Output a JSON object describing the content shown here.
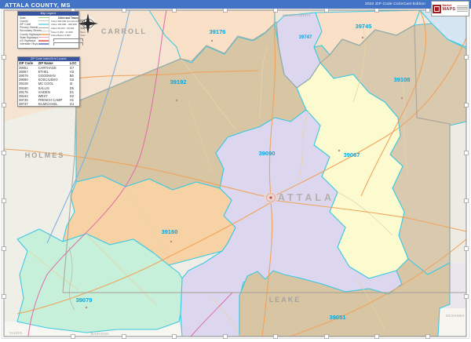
{
  "header": {
    "title": "ATTALA COUNTY, MS",
    "edition": "2022 ZIP Code ColorCast Edition",
    "logo_brand_top": "Market",
    "logo_brand_bottom": "MAPS"
  },
  "legend": {
    "title": "Map Legend",
    "items": [
      {
        "label": "State",
        "color": "#9dd17e"
      },
      {
        "label": "County",
        "color": "#c9c4ba"
      },
      {
        "label": "ZIP Code",
        "color": "#8fdcec"
      },
      {
        "label": "Primary Streets",
        "color": "#a8a29a"
      },
      {
        "label": "Secondary Streets",
        "color": "#d8d2c8"
      },
      {
        "label": "County Highways",
        "color": "#f4b97c"
      },
      {
        "label": "State Highways",
        "color": "#f39bc3"
      },
      {
        "label": "US Highways",
        "color": "#e87b74"
      },
      {
        "label": "Interstate Hwys",
        "color": "#7b93d8"
      }
    ],
    "cities_title": "Cities and Towns",
    "cities": [
      {
        "label": "Cities 500,000 and Above",
        "sample": "CITY"
      },
      {
        "label": "Cities 100,000 - 499,999",
        "sample": "City"
      },
      {
        "label": "Cities 25,000 - 99,999",
        "sample": "City"
      },
      {
        "label": "Cities 5,000 - 24,999",
        "sample": "Town"
      },
      {
        "label": "Cities Below 5,000",
        "sample": "Town"
      }
    ]
  },
  "zip_table": {
    "title": "ZIP Code Index/Grid Locator",
    "columns": [
      "ZIP Code",
      "ZIP Name",
      "LOC"
    ],
    "rows": [
      {
        "zip": "39051",
        "name": "CARTHAGE",
        "loc": "G7"
      },
      {
        "zip": "39067",
        "name": "ETHEL",
        "loc": "H3"
      },
      {
        "zip": "39079",
        "name": "GOODMAN",
        "loc": "B6"
      },
      {
        "zip": "39090",
        "name": "KOSCIUSKO",
        "loc": "G5"
      },
      {
        "zip": "39108",
        "name": "MC COOL",
        "loc": "I3"
      },
      {
        "zip": "39160",
        "name": "SALLIS",
        "loc": "D5"
      },
      {
        "zip": "39176",
        "name": "VAIDEN",
        "loc": "D1"
      },
      {
        "zip": "39192",
        "name": "WEST",
        "loc": "D2"
      },
      {
        "zip": "39745",
        "name": "FRENCH CAMP",
        "loc": "H1"
      },
      {
        "zip": "39747",
        "name": "KILMICHAEL",
        "loc": "G1"
      }
    ]
  },
  "map": {
    "zip_labels": [
      "39176",
      "39745",
      "39747",
      "39192",
      "39108",
      "39090",
      "39067",
      "39160",
      "39079",
      "39051"
    ],
    "county_labels": {
      "carroll": "CARROLL",
      "montgomery": "MONTGOMERY",
      "holmes": "HOLMES",
      "attala": "ATTALA",
      "leake": "LEAKE",
      "yazoo": "YAZOO",
      "madison": "MADISON",
      "neshoba": "NESHOBA"
    },
    "colors": {
      "zip_label": "#00a9e6",
      "boundary_cyan": "#3fc8e2",
      "region_peach": "#f9e0c6",
      "region_tan": "#d7c5a4",
      "region_lavender": "#dcd7ee",
      "region_yellow": "#fcfbcf",
      "region_orange": "#f7d2a4",
      "region_mint": "#c6f0d9",
      "header_blue": "#4273c4"
    }
  }
}
